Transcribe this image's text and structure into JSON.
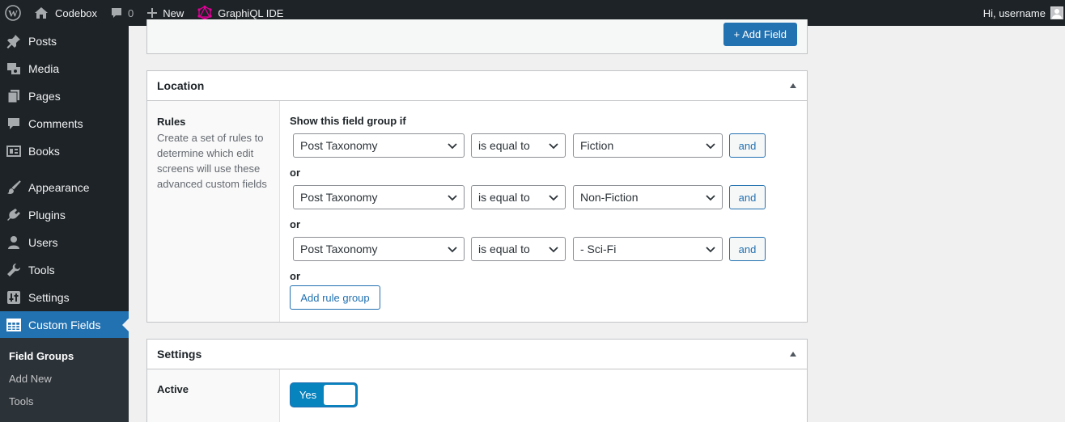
{
  "adminbar": {
    "site_name": "Codebox",
    "comments_count": "0",
    "new_label": "New",
    "graphiql_label": "GraphiQL IDE",
    "greeting": "Hi, username"
  },
  "sidebar": {
    "items": [
      {
        "label": "Posts",
        "icon": "pin-icon"
      },
      {
        "label": "Media",
        "icon": "media-icon"
      },
      {
        "label": "Pages",
        "icon": "pages-icon"
      },
      {
        "label": "Comments",
        "icon": "comment-icon"
      },
      {
        "label": "Books",
        "icon": "books-icon"
      },
      {
        "label": "Appearance",
        "icon": "brush-icon"
      },
      {
        "label": "Plugins",
        "icon": "plugin-icon"
      },
      {
        "label": "Users",
        "icon": "user-icon"
      },
      {
        "label": "Tools",
        "icon": "wrench-icon"
      },
      {
        "label": "Settings",
        "icon": "settings-icon"
      },
      {
        "label": "Custom Fields",
        "icon": "table-icon"
      }
    ],
    "submenu": [
      "Field Groups",
      "Add New",
      "Tools"
    ]
  },
  "top_panel": {
    "add_field_label": "+ Add Field"
  },
  "location": {
    "title": "Location",
    "rules_label": "Rules",
    "rules_desc": "Create a set of rules to determine which edit screens will use these advanced custom fields",
    "show_if": "Show this field group if",
    "or_label": "or",
    "rules": [
      {
        "param": "Post Taxonomy",
        "operator": "is equal to",
        "value": "Fiction",
        "and": "and"
      },
      {
        "param": "Post Taxonomy",
        "operator": "is equal to",
        "value": "Non-Fiction",
        "and": "and"
      },
      {
        "param": "Post Taxonomy",
        "operator": "is equal to",
        "value": "- Sci-Fi",
        "and": "and"
      }
    ],
    "add_rule_group": "Add rule group"
  },
  "settings": {
    "title": "Settings",
    "active_label": "Active",
    "active_value": "Yes"
  },
  "colors": {
    "accent": "#2271b1",
    "adminbar": "#1d2327",
    "switch_on": "#0783be"
  }
}
